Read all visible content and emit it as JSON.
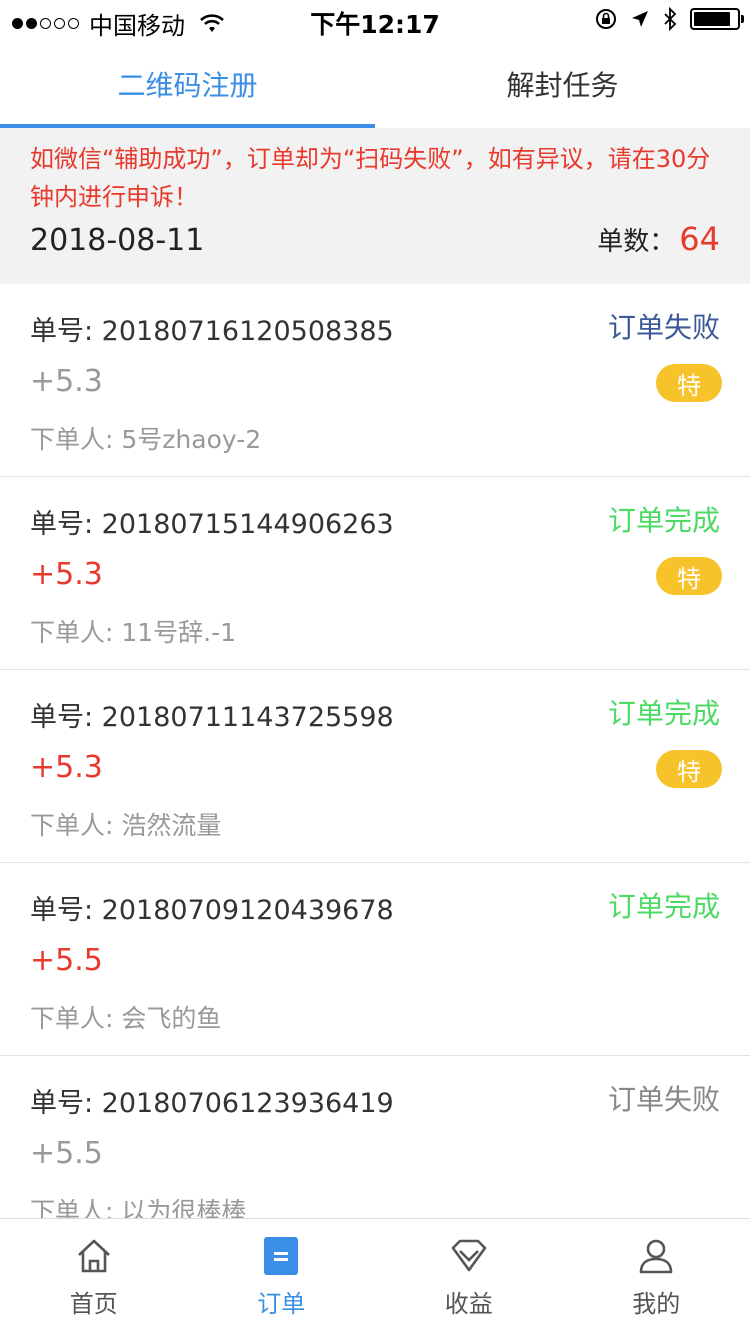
{
  "status_bar": {
    "carrier": "中国移动",
    "time": "下午12:17",
    "signal_bars_filled": 2,
    "signal_bars_total": 5,
    "battery_level": 0.85
  },
  "tabs": [
    {
      "label": "二维码注册",
      "active": true
    },
    {
      "label": "解封任务",
      "active": false
    }
  ],
  "notice": {
    "text": "如微信“辅助成功”，订单却为“扫码失败”，如有异议，请在30分钟内进行申诉！",
    "date": "2018-08-11",
    "count_label": "单数：",
    "count_value": "64"
  },
  "colors": {
    "accent": "#3a8ee6",
    "danger": "#e8392c",
    "success": "#4cd964",
    "fail_blue": "#3b5998",
    "muted": "#999999",
    "tag": "#f6c42a"
  },
  "orders": [
    {
      "order_no": "单号: 20180716120508385",
      "status": "订单失败",
      "status_color": "#3b5998",
      "amount": "+5.3",
      "amount_color": "#999999",
      "buyer": "下单人: 5号zhaoy-2",
      "tag": "特"
    },
    {
      "order_no": "单号: 20180715144906263",
      "status": "订单完成",
      "status_color": "#4cd964",
      "amount": "+5.3",
      "amount_color": "#e8392c",
      "buyer": "下单人: 11号辞.-1",
      "tag": "特"
    },
    {
      "order_no": "单号: 20180711143725598",
      "status": "订单完成",
      "status_color": "#4cd964",
      "amount": "+5.3",
      "amount_color": "#e8392c",
      "buyer": "下单人: 浩然流量",
      "tag": "特"
    },
    {
      "order_no": "单号: 20180709120439678",
      "status": "订单完成",
      "status_color": "#4cd964",
      "amount": "+5.5",
      "amount_color": "#e8392c",
      "buyer": "下单人: 会飞的鱼",
      "tag": ""
    },
    {
      "order_no": "单号: 20180706123936419",
      "status": "订单失败",
      "status_color": "#888888",
      "amount": "+5.5",
      "amount_color": "#999999",
      "buyer": "下单人: 以为很棒棒",
      "tag": ""
    }
  ],
  "bottom_nav": [
    {
      "label": "首页",
      "icon": "home-icon",
      "active": false
    },
    {
      "label": "订单",
      "icon": "order-icon",
      "active": true
    },
    {
      "label": "收益",
      "icon": "diamond-icon",
      "active": false
    },
    {
      "label": "我的",
      "icon": "user-icon",
      "active": false
    }
  ]
}
